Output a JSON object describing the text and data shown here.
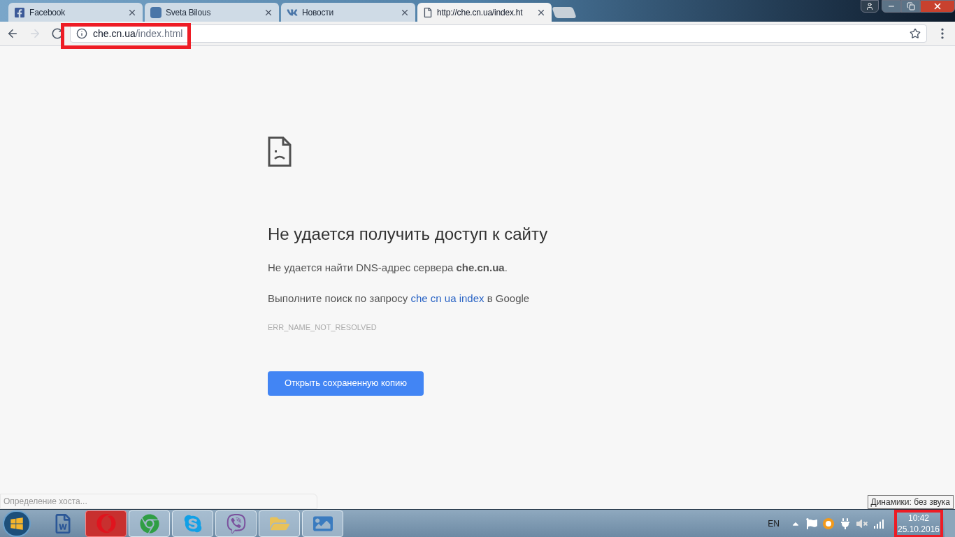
{
  "tabs": [
    {
      "kind": "facebook",
      "title": "Facebook",
      "selected": false
    },
    {
      "kind": "letter",
      "title": "Sveta Bilous",
      "selected": false
    },
    {
      "kind": "vk",
      "title": "Новости",
      "selected": false
    },
    {
      "kind": "page",
      "title": "http://che.cn.ua/index.ht",
      "selected": true
    }
  ],
  "toolbar": {
    "nav": [
      {
        "kind": "back",
        "disabled": false
      },
      {
        "kind": "forward",
        "disabled": true
      },
      {
        "kind": "reload",
        "disabled": false
      }
    ],
    "url_host": "che.cn.ua",
    "url_path": "/index.html"
  },
  "error_page": {
    "title": "Не удается получить доступ к сайту",
    "dns_message": "Не удается найти DNS-адрес сервера **che.cn.ua**.",
    "search_prefix": "Выполните поиск по запросу",
    "search_link": "che cn ua index",
    "search_suffix": "в Google",
    "error_code": "ERR_NAME_NOT_RESOLVED",
    "button": "Открыть сохраненную копию"
  },
  "status_bubble": "Определение хоста...",
  "taskbar": {
    "apps": [
      {
        "kind": "word",
        "highlighted": false
      },
      {
        "kind": "opera",
        "highlighted": true
      },
      {
        "kind": "chrome",
        "highlighted": false
      },
      {
        "kind": "skype",
        "highlighted": false
      },
      {
        "kind": "viber",
        "highlighted": false
      },
      {
        "kind": "explorer",
        "highlighted": false
      },
      {
        "kind": "photos",
        "highlighted": false
      }
    ],
    "language": "EN",
    "time": "10:42",
    "date": "25.10.2016",
    "tooltip": "Динамики: без звука"
  }
}
